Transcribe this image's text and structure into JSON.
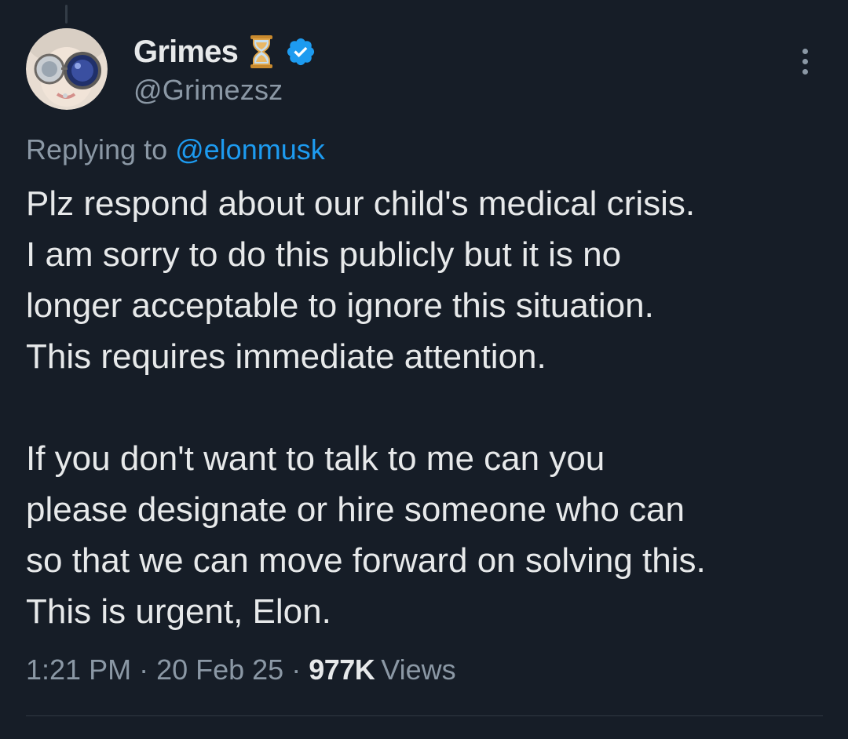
{
  "author": {
    "display_name": "Grimes",
    "handle": "@Grimezsz",
    "badge_emoji": "hourglass-icon",
    "verified": true,
    "verified_color": "#1d9bf0"
  },
  "reply": {
    "prefix": "Replying to ",
    "mention": "@elonmusk"
  },
  "tweet": {
    "paragraphs": [
      "Plz respond about our child's medical crisis.\nI am sorry to do this publicly but it is no\nlonger acceptable to ignore this situation.\nThis requires immediate attention.",
      "If you don't want to talk to me can you\nplease designate or hire someone who can\nso that we can move forward on solving this.\nThis is urgent, Elon."
    ]
  },
  "meta": {
    "time": "1:21 PM",
    "separator": "·",
    "date": "20 Feb 25",
    "views_count": "977K",
    "views_label": "Views"
  },
  "colors": {
    "background": "#161d27",
    "text": "#e7e9ea",
    "muted": "#8b98a5",
    "accent": "#1d9bf0"
  }
}
